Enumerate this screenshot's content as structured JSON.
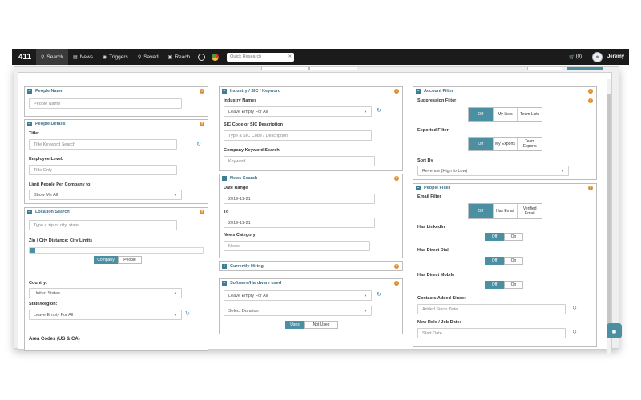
{
  "nav": {
    "logo": "411",
    "items": [
      {
        "label": "Search",
        "icon": "search-icon"
      },
      {
        "label": "News",
        "icon": "news-icon"
      },
      {
        "label": "Triggers",
        "icon": "triggers-icon"
      },
      {
        "label": "Saved",
        "icon": "saved-icon"
      },
      {
        "label": "Reach",
        "icon": "reach-icon"
      }
    ],
    "quick_search_placeholder": "Quick Research",
    "cart_count": "(0)",
    "user_name": "Jeremy"
  },
  "people_name": {
    "title": "People Name",
    "placeholder": "People Name"
  },
  "people_details": {
    "title": "People Details",
    "title_label": "Title:",
    "title_placeholder": "Title Keyword Search",
    "employee_level_label": "Employee Level:",
    "employee_level_placeholder": "Title Only",
    "limit_label": "Limit People Per Company to:",
    "limit_value": "Show Me All"
  },
  "location": {
    "title": "Location Search",
    "placeholder": "Type a zip or city, state",
    "distance_label": "Zip / City Distance: City Limits",
    "toggle": [
      "Company",
      "People"
    ],
    "country_label": "Country:",
    "country_value": "United States",
    "state_label": "State/Region:",
    "state_value": "Leave Empty For All",
    "area_codes_label": "Area Codes (US & CA)"
  },
  "industry": {
    "title": "Industry / SIC / Keyword",
    "industry_label": "Industry Names",
    "industry_value": "Leave Empty For All",
    "sic_label": "SIC Code or SIC Description",
    "sic_placeholder": "Type a SIC Code / Description",
    "keyword_label": "Company Keyword Search",
    "keyword_placeholder": "Keyword"
  },
  "news": {
    "title": "News Search",
    "date_range_label": "Date Range",
    "from_value": "2019-11-21",
    "to_label": "To",
    "to_value": "2019-11-21",
    "category_label": "News Category",
    "category_placeholder": "News"
  },
  "hiring": {
    "title": "Currently Hiring"
  },
  "software": {
    "title": "Software/Hardware used",
    "value": "Leave Empty For All",
    "duration_placeholder": "Select Duration",
    "toggle": [
      "Uses",
      "Not Used"
    ]
  },
  "account_filter": {
    "title": "Account Filter",
    "suppression_label": "Suppression Filter",
    "suppression_options": [
      "Off",
      "My Lists",
      "Team Lists"
    ],
    "exported_label": "Exported Filter",
    "exported_options": [
      "Off",
      "My Exports",
      "Team Exports"
    ],
    "sort_label": "Sort By",
    "sort_value": "Revenue (High to Low)"
  },
  "people_filter": {
    "title": "People Filter",
    "email_label": "Email Filter",
    "email_options": [
      "Off",
      "Has Email",
      "Verified Email"
    ],
    "linkedin_label": "Has LinkedIn",
    "direct_dial_label": "Has Direct Dial",
    "direct_mobile_label": "Has Direct Mobile",
    "toggle_options": [
      "Off",
      "On"
    ],
    "contacts_added_label": "Contacts Added Since:",
    "contacts_added_placeholder": "Added Since Date",
    "new_role_label": "New Role / Job Date:",
    "new_role_placeholder": "Start Date"
  }
}
